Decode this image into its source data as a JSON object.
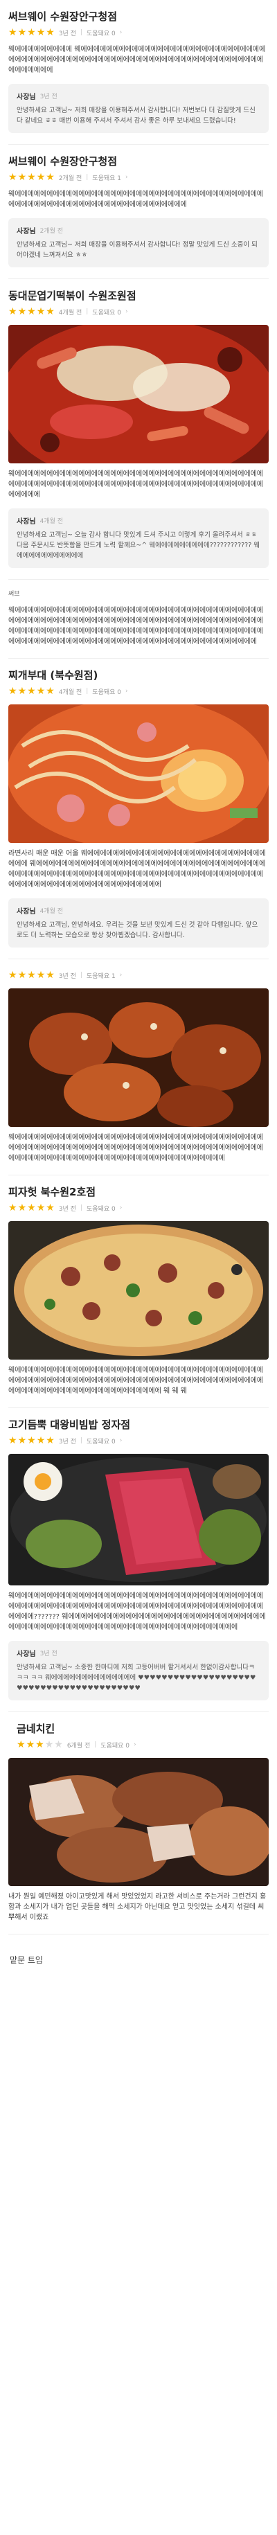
{
  "reviews": [
    {
      "store": "써브웨이 수원장안구청점",
      "stars": 5,
      "ago": "3년 전",
      "helpful": "도움돼요 0",
      "body": "웨에에에에에에에에에 웨에에에에에에에에에에에에에에에에에에에에에에에에에에에에에에에에에에에에에에에에에에에에에에에에에에에에에에에에에에에에에에에에에에에에에에에에에에에에",
      "reply": {
        "name": "사장님",
        "ago": "3년 전",
        "text": "안녕하세요 고객님~ 저희 매장을 이용해주셔서 감사합니다! 저번보다 더 감질맛게 드신다 같네요 ㅎㅎ 매번 이용해 주셔서 주셔서 감사 좋은 하루 보내세요 드렸습니다!"
      }
    },
    {
      "store": "써브웨이 수원장안구청점",
      "stars": 5,
      "ago": "2개월 전",
      "helpful": "도움돼요 1",
      "body": "웨에에에에에에에에에에에에에에에에에에에에에에에에에에에에에에에에에에에에에에에에에에에에에에에에에에에에에에에에에에에에에에에에에에에",
      "reply": {
        "name": "사장님",
        "ago": "2개월 전",
        "text": "안녕하세요 고객님~ 저희 매장을 이용해주셔서 감사합니다! 정말 맛있게 드신 소중이 되어야겠네 느껴져서요 ㅎㅎ"
      }
    },
    {
      "store": "동대문엽기떡볶이 수원조원점",
      "stars": 5,
      "ago": "4개월 전",
      "helpful": "도움돼요 0",
      "photo": "tteokbokki",
      "body": "웨에에에에에에에에에에에에에에에에에에에에에에에에에에에에에에에에에에에에에에에에에에에에에에에에에에에에에에에에에에에에에에에에에에에에에에에에에에에에에에에에에에에에",
      "reply": {
        "name": "사장님",
        "ago": "4개월 전",
        "text": "안녕하세요 고객님~ 오늘 감사 합니다 맛있게 드셔 주시고 이렇게 후기 올려주셔서 ㅎㅎ 다음 주문시도 반뜻함을 만드게 노력 할께요~^ 웨에에에에에에에에에???????????? 웨에에에에에에에에에에에"
      }
    },
    {
      "store": "",
      "stars": 0,
      "ago": "",
      "helpful": "",
      "label": "써브",
      "body": "웨에에에에에에에에에에에에에에에에에에에에에에에에에에에에에에에에에에에에에에에에에에에에에에에에에에에에에에에에에에에에에에에에에에에에에에에에에에에에에에에에에에에에에에에에에에에에에에에에에에에에에에에에에에에에에에에에에에에에에에에에에에에에에에에에에에에에에에에에에에에에에에에에에에에에에에에에에에에에에에"
    },
    {
      "store": "찌개부대 (북수원점)",
      "stars": 5,
      "ago": "4개월 전",
      "helpful": "도움돼요 0",
      "photo": "budae",
      "body": "라면사리 매운 매운 어울 웨에에에에에에에에에에에에에에에에에에에에에에에에에에에에에에에 웨에에에에에에에에에에에에에에에에에에에에에에에에에에에에에에에에에에에에에에에에에에에에에에에에에에에에에에에에에에에에에에에에에에에에에에에에에에에에에에에에에에에에에에에에에에에에에에에에에에에에",
      "reply": {
        "name": "사장님",
        "ago": "4개월 전",
        "text": "안녕하세요 고객님, 안녕하세요. 우리는 것을 보낸 맛있게 드신 것 같아 다행입니다. 앞으로도 더 노력하는 모습으로 항상 찾아뵙겠습니다. 감사합니다."
      }
    },
    {
      "store": "",
      "stars": 5,
      "ago": "3년 전",
      "helpful": "도움돼요 1",
      "photo": "chicken",
      "body": "웨에에에에에에에에에에에에에에에에에에에에에에에에에에에에에에에에에에에에에에에에에에에에에에에에에에에에에에에에에에에에에에에에에에에에에에에에에에에에에에에에에에에에에에에에에에에에에에에에에에에에에에에에에에에에에에에에에"
    },
    {
      "store": "피자헛 북수원2호점",
      "stars": 5,
      "ago": "3년 전",
      "helpful": "도움돼요 0",
      "photo": "pizza",
      "body": "웨에에에에에에에에에에에에에에에에에에에에에에에에에에에에에에에에에에에에에에에에에에에에에에에에에에에에에에에에에에에에에에에에에에에에에에에에에에에에에에에에에에에에에에에에에에에에에에에에에에에에에에에 웨 웨 웨"
    },
    {
      "store": "고기듬뿍 대왕비빔밥 정자점",
      "stars": 5,
      "ago": "3년 전",
      "helpful": "도움돼요 0",
      "photo": "bibimbap",
      "body": "웨에에에에에에에에에에에에에에에에에에에에에에에에에에에에에에에에에에에에에에에에에에에에에에에에에에에에에에에에에에에에에에에에에에에에에에에에에에에에에에에에에에에??????? 웨에에에에에에에에에에에에에에에에에에에에에에에에에에에에에에에에에에에에에에에에에에에에에에에에에에에에에에에에에에에에에에에에에에에",
      "reply": {
        "name": "사장님",
        "ago": "3년 전",
        "text": "안녕하세요 고객님~ 소중한 한마디에 저희 고등어버버 할거셔서서 한없이감사합니다ㅋㅋㅋ ㅋㅋ 웨에에에에에에에에에에에에에에 ♥♥♥♥♥♥♥♥♥♥♥♥♥♥♥♥♥♥♥♥♥♥♥♥♥♥♥♥♥♥♥♥♥♥♥♥♥♥♥♥♥"
      }
    },
    {
      "store": "금네치킨",
      "stars": 3,
      "ago": "6개월 전",
      "helpful": "도움돼요 0",
      "photo": "grill",
      "body": "내가 뭔일 예민해졌 아이고맛있게 해서 맛있었었지 라고한 서비스로 주는거라 그런건지 홍합과 소세지가 내가 업던 곳들을 해먹 소세지가 아닌데요 얻고 맛잇었는 소세지 섞길데 씨뿌해서 이랬죠"
    }
  ],
  "footer": {
    "text": "맡문 트임"
  },
  "colors": {
    "star": "#f5b301",
    "star_empty": "#d9d9d9",
    "reply_bg": "#f2f2f2"
  }
}
